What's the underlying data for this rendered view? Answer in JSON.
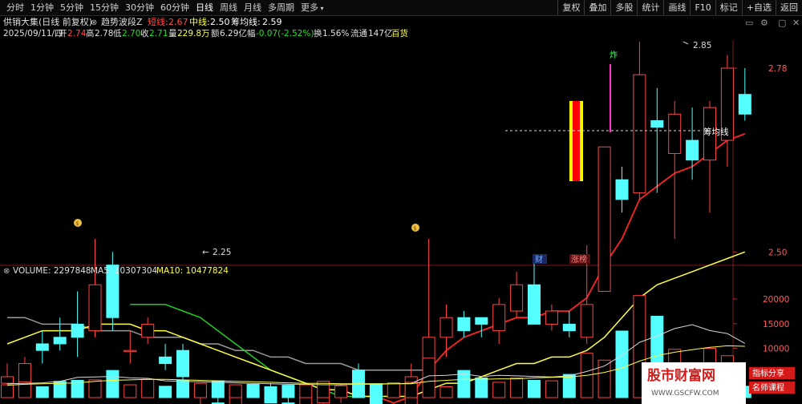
{
  "toolbar": {
    "period_tabs": [
      "分时",
      "1分钟",
      "5分钟",
      "15分钟",
      "30分钟",
      "60分钟",
      "日线",
      "周线",
      "月线",
      "多周期",
      "更多"
    ],
    "active_tab": "日线",
    "tools": [
      "复权",
      "叠加",
      "多股",
      "统计",
      "画线",
      "F10",
      "标记",
      "+自选",
      "返回"
    ]
  },
  "header": {
    "stock_name": "供销大集(日线 前复权)",
    "indicator_name": "趋势波段Z",
    "short_line_label": "短线:",
    "short_line_value": "2.67",
    "mid_line_label": "中线:",
    "mid_line_value": "2.50",
    "avg_cost_label": "筹均线:",
    "avg_cost_value": "2.59",
    "date": "2025/09/11/四",
    "open_label": "开",
    "open": "2.74",
    "high_label": "高",
    "high": "2.78",
    "low_label": "低",
    "low": "2.70",
    "close_label": "收",
    "close": "2.71",
    "volume_label": "量",
    "volume": "229.8万",
    "amount_label": "额",
    "amount": "6.29亿",
    "change_label": "幅",
    "change": "-0.07(-2.52%)",
    "turnover_label": "换",
    "turnover": "1.56%",
    "float_label": "流通",
    "float_cap": "147亿",
    "sector": "百货"
  },
  "chart_data": {
    "type": "candlestick",
    "price_axis": {
      "ticks": [
        "2.78",
        "2.50",
        "2.25"
      ],
      "ylim": [
        2.21,
        2.85
      ]
    },
    "annotations": {
      "high_mark": "2.85",
      "low_mark": "2.25",
      "avg_cost_line": "筹均线",
      "signal": "炸",
      "news_flag": "财",
      "limit_up_flag": "涨榜"
    },
    "colors": {
      "up": "#ff4444",
      "down": "#54ffff",
      "short_line": "#ff2424",
      "mid_line": "#ffff44",
      "indicator_green": "#22cc22",
      "indicator_gray": "#9a9a9a"
    },
    "candles": [
      {
        "o": 2.3,
        "h": 2.33,
        "l": 2.29,
        "c": 2.31
      },
      {
        "o": 2.29,
        "h": 2.34,
        "l": 2.29,
        "c": 2.33
      },
      {
        "o": 2.36,
        "h": 2.38,
        "l": 2.33,
        "c": 2.35
      },
      {
        "o": 2.37,
        "h": 2.4,
        "l": 2.35,
        "c": 2.36
      },
      {
        "o": 2.39,
        "h": 2.44,
        "l": 2.34,
        "c": 2.37
      },
      {
        "o": 2.38,
        "h": 2.52,
        "l": 2.37,
        "c": 2.45
      },
      {
        "o": 2.48,
        "h": 2.5,
        "l": 2.38,
        "c": 2.4
      },
      {
        "o": 2.35,
        "h": 2.38,
        "l": 2.33,
        "c": 2.35
      },
      {
        "o": 2.37,
        "h": 2.4,
        "l": 2.36,
        "c": 2.39
      },
      {
        "o": 2.34,
        "h": 2.36,
        "l": 2.32,
        "c": 2.33
      },
      {
        "o": 2.35,
        "h": 2.36,
        "l": 2.29,
        "c": 2.31
      },
      {
        "o": 2.28,
        "h": 2.3,
        "l": 2.26,
        "c": 2.29
      },
      {
        "o": 2.27,
        "h": 2.29,
        "l": 2.25,
        "c": 2.26
      },
      {
        "o": 2.26,
        "h": 2.29,
        "l": 2.26,
        "c": 2.29
      },
      {
        "o": 2.29,
        "h": 2.3,
        "l": 2.28,
        "c": 2.28
      },
      {
        "o": 2.28,
        "h": 2.3,
        "l": 2.27,
        "c": 2.27
      },
      {
        "o": 2.27,
        "h": 2.28,
        "l": 2.26,
        "c": 2.26
      },
      {
        "o": 2.26,
        "h": 2.29,
        "l": 2.25,
        "c": 2.28
      },
      {
        "o": 2.27,
        "h": 2.29,
        "l": 2.26,
        "c": 2.29
      },
      {
        "o": 2.28,
        "h": 2.3,
        "l": 2.27,
        "c": 2.29
      },
      {
        "o": 2.32,
        "h": 2.33,
        "l": 2.3,
        "c": 2.3
      },
      {
        "o": 2.29,
        "h": 2.29,
        "l": 2.25,
        "c": 2.25
      },
      {
        "o": 2.25,
        "h": 2.27,
        "l": 2.24,
        "c": 2.26
      },
      {
        "o": 2.26,
        "h": 2.33,
        "l": 2.25,
        "c": 2.31
      },
      {
        "o": 2.32,
        "h": 2.52,
        "l": 2.31,
        "c": 2.37
      },
      {
        "o": 2.37,
        "h": 2.42,
        "l": 2.34,
        "c": 2.4
      },
      {
        "o": 2.4,
        "h": 2.41,
        "l": 2.37,
        "c": 2.38
      },
      {
        "o": 2.4,
        "h": 2.4,
        "l": 2.37,
        "c": 2.39
      },
      {
        "o": 2.38,
        "h": 2.43,
        "l": 2.36,
        "c": 2.42
      },
      {
        "o": 2.41,
        "h": 2.47,
        "l": 2.4,
        "c": 2.45
      },
      {
        "o": 2.45,
        "h": 2.49,
        "l": 2.39,
        "c": 2.39
      },
      {
        "o": 2.39,
        "h": 2.42,
        "l": 2.38,
        "c": 2.41
      },
      {
        "o": 2.39,
        "h": 2.41,
        "l": 2.37,
        "c": 2.38
      },
      {
        "o": 2.37,
        "h": 2.51,
        "l": 2.36,
        "c": 2.42
      },
      {
        "o": 2.44,
        "h": 2.66,
        "l": 2.44,
        "c": 2.66
      },
      {
        "o": 2.61,
        "h": 2.63,
        "l": 2.56,
        "c": 2.58
      },
      {
        "o": 2.59,
        "h": 2.82,
        "l": 2.58,
        "c": 2.77
      },
      {
        "o": 2.7,
        "h": 2.75,
        "l": 2.59,
        "c": 2.69
      },
      {
        "o": 2.65,
        "h": 2.73,
        "l": 2.52,
        "c": 2.71
      },
      {
        "o": 2.67,
        "h": 2.72,
        "l": 2.61,
        "c": 2.64
      },
      {
        "o": 2.64,
        "h": 2.73,
        "l": 2.56,
        "c": 2.72
      },
      {
        "o": 2.67,
        "h": 2.8,
        "l": 2.63,
        "c": 2.78
      },
      {
        "o": 2.74,
        "h": 2.78,
        "l": 2.7,
        "c": 2.71
      }
    ],
    "short_line": [
      2.31,
      2.33,
      2.35,
      2.37,
      2.39,
      2.41,
      2.42,
      2.42,
      2.42,
      2.42,
      2.41,
      2.4,
      2.38,
      2.36,
      2.34,
      2.32,
      2.31,
      2.3,
      2.29,
      2.28,
      2.28,
      2.28,
      2.27,
      2.28,
      2.32,
      2.35,
      2.37,
      2.38,
      2.39,
      2.4,
      2.4,
      2.41,
      2.41,
      2.43,
      2.48,
      2.52,
      2.58,
      2.6,
      2.62,
      2.63,
      2.65,
      2.67,
      2.68
    ],
    "mid_line": [
      2.36,
      2.37,
      2.38,
      2.38,
      2.38,
      2.39,
      2.39,
      2.39,
      2.38,
      2.38,
      2.37,
      2.36,
      2.35,
      2.34,
      2.33,
      2.32,
      2.31,
      2.3,
      2.29,
      2.29,
      2.28,
      2.28,
      2.28,
      2.28,
      2.29,
      2.3,
      2.3,
      2.31,
      2.32,
      2.33,
      2.33,
      2.34,
      2.34,
      2.35,
      2.37,
      2.4,
      2.43,
      2.45,
      2.46,
      2.47,
      2.48,
      2.49,
      2.5
    ],
    "gray_line": [
      2.4,
      2.4,
      2.39,
      2.39,
      2.39,
      2.38,
      2.38,
      2.38,
      2.37,
      2.37,
      2.37,
      2.36,
      2.36,
      2.35,
      2.35,
      2.34,
      2.34,
      2.33,
      2.33,
      2.33,
      2.32,
      2.32,
      2.32,
      2.32,
      2.32
    ],
    "avg_cost_level": 2.59,
    "volume": {
      "header": "VOLUME: 2297848",
      "ma5_label": "MA5: 10307304",
      "ma10_label": "MA10: 10477824",
      "ticks": [
        "20000",
        "15000",
        "10000"
      ],
      "ylim": [
        0,
        23000
      ],
      "values_wan": [
        2600,
        3200,
        2200,
        3300,
        3500,
        3600,
        5500,
        2600,
        3700,
        2300,
        3500,
        2900,
        3400,
        2600,
        2700,
        2200,
        2500,
        2600,
        3300,
        2400,
        2700,
        2800,
        3000,
        3100,
        8000,
        2200,
        5500,
        4000,
        3100,
        4000,
        3500,
        3400,
        4700,
        9000,
        7600,
        13500,
        20700,
        16500,
        9800,
        7000,
        10000,
        8500,
        2300
      ],
      "ma5": [
        2800,
        2900,
        3000,
        3300,
        4100,
        4200,
        4300,
        4000,
        3900,
        3400,
        3300,
        3200,
        3100,
        3000,
        2900,
        2800,
        2700,
        2700,
        2600,
        2600,
        2700,
        2700,
        2800,
        2900,
        4400,
        4500,
        4800,
        4300,
        4500,
        4400,
        4300,
        4200,
        4400,
        5300,
        6400,
        8600,
        11200,
        12500,
        14000,
        14800,
        13600,
        13000,
        11000
      ],
      "ma10": [
        2500,
        2700,
        2800,
        2900,
        3000,
        3300,
        3500,
        3600,
        3700,
        3700,
        3600,
        3500,
        3400,
        3300,
        3200,
        3100,
        3000,
        2900,
        2900,
        2800,
        2800,
        2800,
        2800,
        2800,
        3300,
        3500,
        3700,
        3700,
        3800,
        3800,
        4000,
        4100,
        4200,
        4500,
        5100,
        6000,
        7400,
        8500,
        9200,
        9700,
        10200,
        10500,
        10400
      ]
    },
    "watermark": {
      "line1": "股市财富网",
      "line2": "WWW.GSCFW.COM",
      "tag1": "指标分享",
      "tag2": "名师课程"
    }
  }
}
